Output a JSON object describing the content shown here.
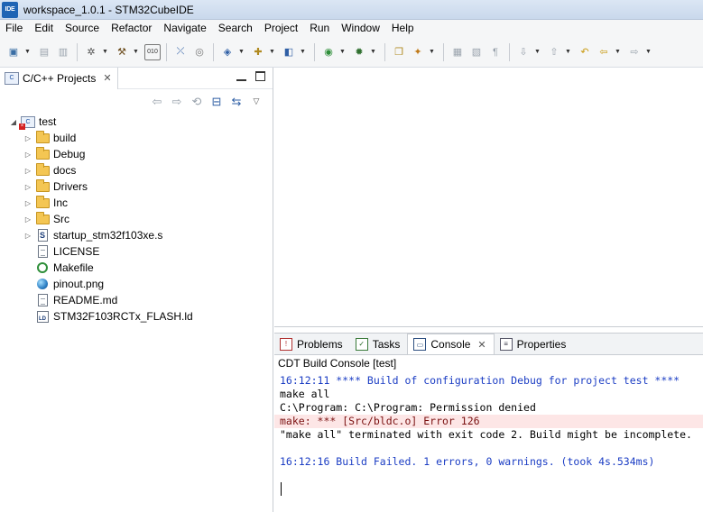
{
  "window": {
    "title": "workspace_1.0.1 - STM32CubeIDE",
    "logo": "IDE"
  },
  "menubar": [
    "File",
    "Edit",
    "Source",
    "Refactor",
    "Navigate",
    "Search",
    "Project",
    "Run",
    "Window",
    "Help"
  ],
  "toolbar": {
    "icons": [
      "new-icon",
      "save-icon",
      "save-all-icon",
      "settings-icon",
      "build-hammer-icon",
      "binary-010-icon",
      "debug-disconnect-icon",
      "target-icon",
      "new-cpp-project-icon",
      "new-file-icon",
      "new-class-icon",
      "run-icon",
      "debug-icon",
      "open-folder-icon",
      "magic-wand-icon",
      "toggle-annotation-icon",
      "toggle-block-icon",
      "show-whitespace-icon",
      "next-annotation-icon",
      "prev-annotation-icon",
      "last-edit-icon",
      "back-icon",
      "forward-icon"
    ],
    "binary_label": "010"
  },
  "left_view": {
    "tab_label": "C/C++ Projects",
    "tab_icon_label": "C",
    "tree": [
      {
        "label": "test",
        "type": "project",
        "indent": 0,
        "expanded": true,
        "has_twisty": true
      },
      {
        "label": "build",
        "type": "folder",
        "indent": 1,
        "has_twisty": true
      },
      {
        "label": "Debug",
        "type": "folder",
        "indent": 1,
        "has_twisty": true
      },
      {
        "label": "docs",
        "type": "folder",
        "indent": 1,
        "has_twisty": true
      },
      {
        "label": "Drivers",
        "type": "folder",
        "indent": 1,
        "has_twisty": true
      },
      {
        "label": "Inc",
        "type": "folder",
        "indent": 1,
        "has_twisty": true
      },
      {
        "label": "Src",
        "type": "folder",
        "indent": 1,
        "has_twisty": true
      },
      {
        "label": "startup_stm32f103xe.s",
        "type": "asm",
        "indent": 1,
        "has_twisty": true
      },
      {
        "label": "LICENSE",
        "type": "file",
        "indent": 1,
        "has_twisty": false
      },
      {
        "label": "Makefile",
        "type": "make",
        "indent": 1,
        "has_twisty": false
      },
      {
        "label": "pinout.png",
        "type": "image",
        "indent": 1,
        "has_twisty": false
      },
      {
        "label": "README.md",
        "type": "file",
        "indent": 1,
        "has_twisty": false
      },
      {
        "label": "STM32F103RCTx_FLASH.ld",
        "type": "ld",
        "indent": 1,
        "has_twisty": false
      }
    ],
    "asm_badge": "S",
    "ld_badge": "LD"
  },
  "bottom_tabs": [
    {
      "label": "Problems",
      "icon": "problems-icon",
      "glyph": "!",
      "active": false
    },
    {
      "label": "Tasks",
      "icon": "tasks-icon",
      "glyph": "✓",
      "active": false
    },
    {
      "label": "Console",
      "icon": "console-icon",
      "glyph": "▭",
      "active": true
    },
    {
      "label": "Properties",
      "icon": "properties-icon",
      "glyph": "≡",
      "active": false
    }
  ],
  "console": {
    "title": "CDT Build Console [test]",
    "lines": [
      {
        "text": "16:12:11 **** Build of configuration Debug for project test ****",
        "kind": "info"
      },
      {
        "text": "make all",
        "kind": "plain"
      },
      {
        "text": "C:\\Program: C:\\Program: Permission denied",
        "kind": "plain"
      },
      {
        "text": "make: *** [Src/bldc.o] Error 126",
        "kind": "err"
      },
      {
        "text": "\"make all\" terminated with exit code 2. Build might be incomplete.",
        "kind": "plain"
      },
      {
        "text": "",
        "kind": "plain"
      },
      {
        "text": "16:12:16 Build Failed. 1 errors, 0 warnings. (took 4s.534ms)",
        "kind": "info"
      }
    ]
  },
  "colors": {
    "console_info": "#1b3dc4",
    "console_error_bg": "#fde6e6",
    "folder": "#f4c653"
  }
}
